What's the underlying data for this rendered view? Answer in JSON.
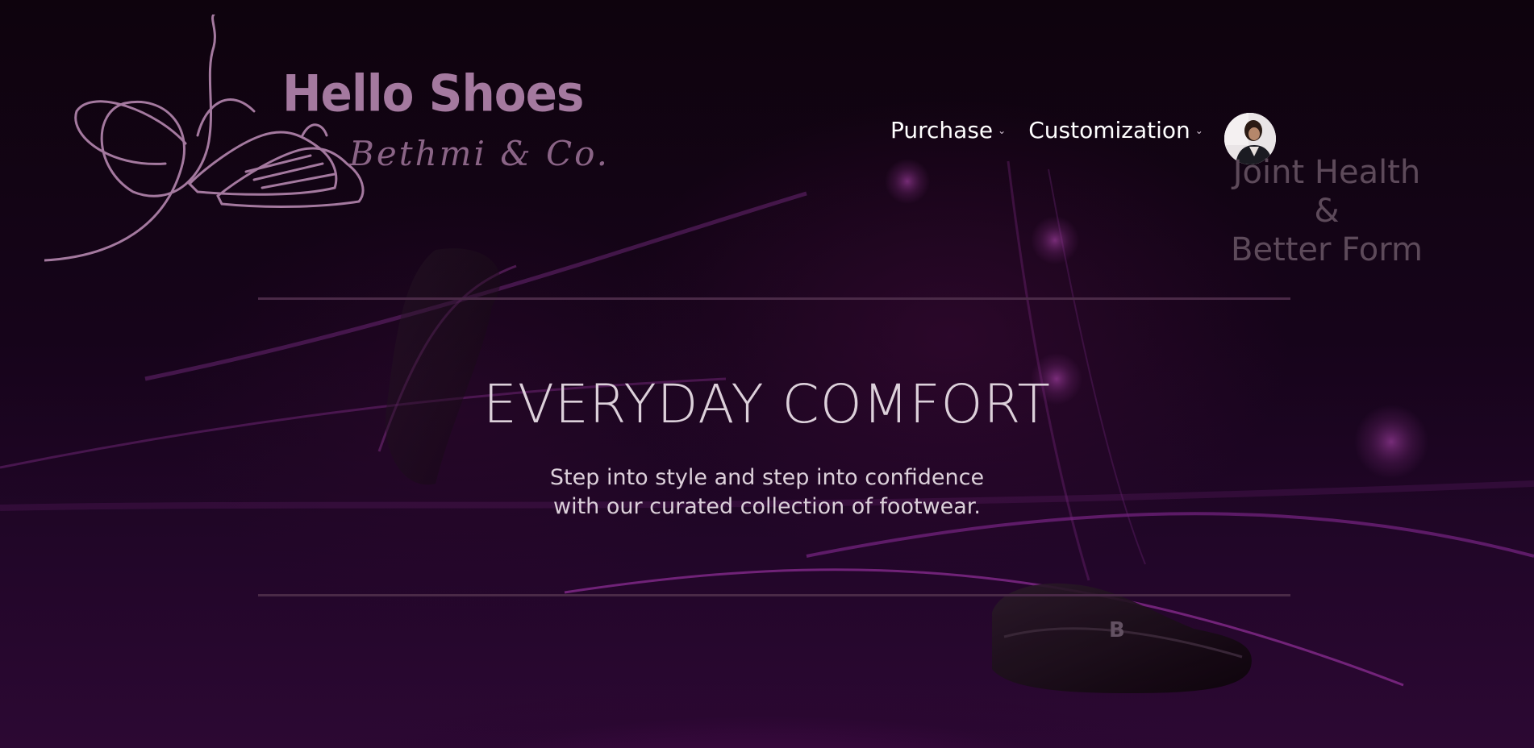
{
  "brand": {
    "name": "Hello Shoes",
    "tagline": "Bethmi & Co."
  },
  "nav": {
    "items": [
      {
        "label": "Purchase",
        "caret": "chevron-down-icon"
      },
      {
        "label": "Customization",
        "caret": "chevron-down-icon"
      }
    ],
    "avatar": "user-avatar"
  },
  "banner_text": {
    "line1": "Joint Health",
    "line2": "&",
    "line3": "Better  Form"
  },
  "hero": {
    "title": "EVERYDAY COMFORT",
    "subtitle_line1": "Step into style and step into confidence",
    "subtitle_line2": "with our curated collection of footwear."
  },
  "colors": {
    "background": "#16041a",
    "accent": "#a4799f",
    "text": "#dcd0da",
    "glow": "#b02fb3"
  }
}
